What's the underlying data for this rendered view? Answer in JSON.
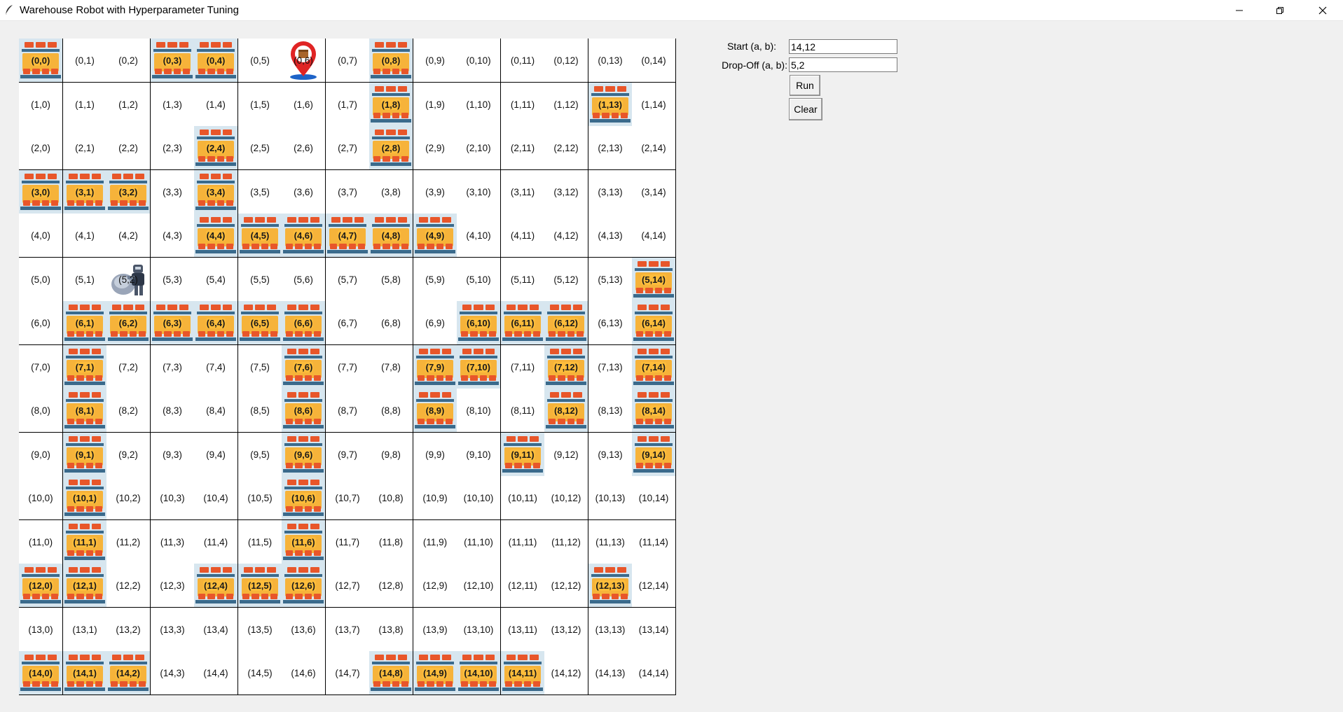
{
  "window": {
    "title": "Warehouse Robot with Hyperparameter Tuning"
  },
  "form": {
    "start_label": "Start (a, b):",
    "start_value": "14,12",
    "dropoff_label": "Drop-Off (a, b):",
    "dropoff_value": "5,2",
    "run_label": "Run",
    "clear_label": "Clear"
  },
  "grid": {
    "rows": 15,
    "cols": 15,
    "shelves": [
      [
        0,
        0
      ],
      [
        0,
        3
      ],
      [
        0,
        4
      ],
      [
        0,
        8
      ],
      [
        1,
        8
      ],
      [
        1,
        13
      ],
      [
        2,
        4
      ],
      [
        2,
        8
      ],
      [
        3,
        0
      ],
      [
        3,
        1
      ],
      [
        3,
        2
      ],
      [
        3,
        4
      ],
      [
        4,
        4
      ],
      [
        4,
        5
      ],
      [
        4,
        6
      ],
      [
        4,
        7
      ],
      [
        4,
        8
      ],
      [
        4,
        9
      ],
      [
        5,
        14
      ],
      [
        6,
        1
      ],
      [
        6,
        2
      ],
      [
        6,
        3
      ],
      [
        6,
        4
      ],
      [
        6,
        5
      ],
      [
        6,
        6
      ],
      [
        6,
        10
      ],
      [
        6,
        11
      ],
      [
        6,
        12
      ],
      [
        6,
        14
      ],
      [
        7,
        1
      ],
      [
        7,
        6
      ],
      [
        7,
        9
      ],
      [
        7,
        10
      ],
      [
        7,
        12
      ],
      [
        7,
        14
      ],
      [
        8,
        1
      ],
      [
        8,
        6
      ],
      [
        8,
        9
      ],
      [
        8,
        12
      ],
      [
        8,
        14
      ],
      [
        9,
        1
      ],
      [
        9,
        6
      ],
      [
        9,
        11
      ],
      [
        9,
        14
      ],
      [
        10,
        1
      ],
      [
        10,
        6
      ],
      [
        11,
        1
      ],
      [
        11,
        6
      ],
      [
        12,
        0
      ],
      [
        12,
        1
      ],
      [
        12,
        4
      ],
      [
        12,
        5
      ],
      [
        12,
        6
      ],
      [
        12,
        13
      ],
      [
        14,
        0
      ],
      [
        14,
        1
      ],
      [
        14,
        2
      ],
      [
        14,
        8
      ],
      [
        14,
        9
      ],
      [
        14,
        10
      ],
      [
        14,
        11
      ]
    ],
    "dropoff_marker": {
      "cell": [
        0,
        6
      ],
      "icon": "location-pin-icon"
    },
    "robot": {
      "cell": [
        5,
        2
      ],
      "icon": "robot-icon"
    }
  }
}
